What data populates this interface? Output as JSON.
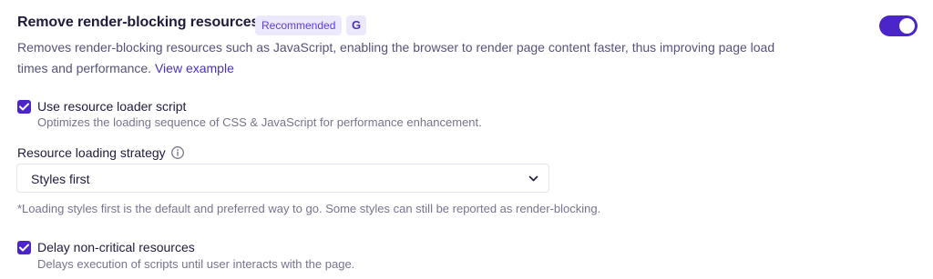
{
  "setting": {
    "title": "Remove render-blocking resources",
    "badge_recommended": "Recommended",
    "badge_g": "G",
    "description": "Removes render-blocking resources such as JavaScript, enabling the browser to render page content faster, thus improving page load times and performance.",
    "view_example_link": "View example",
    "toggle_on": true
  },
  "options": [
    {
      "label": "Use resource loader script",
      "help": "Optimizes the loading sequence of CSS & JavaScript for performance enhancement.",
      "checked": true
    },
    {
      "label": "Delay non-critical resources",
      "help": "Delays execution of scripts until user interacts with the page.",
      "checked": true
    }
  ],
  "strategy": {
    "label": "Resource loading strategy",
    "selected": "Styles first",
    "note": "*Loading styles first is the default and preferred way to go. Some styles can still be reported as render-blocking."
  },
  "colors": {
    "accent": "#4c25c9",
    "badge_bg": "#ede9fd",
    "text": "#1f1b3d",
    "muted": "#77748f"
  },
  "icons": {
    "toggle": "toggle-switch",
    "checkbox": "checkmark-icon",
    "info": "info-icon",
    "dropdown": "chevron-down-icon"
  }
}
